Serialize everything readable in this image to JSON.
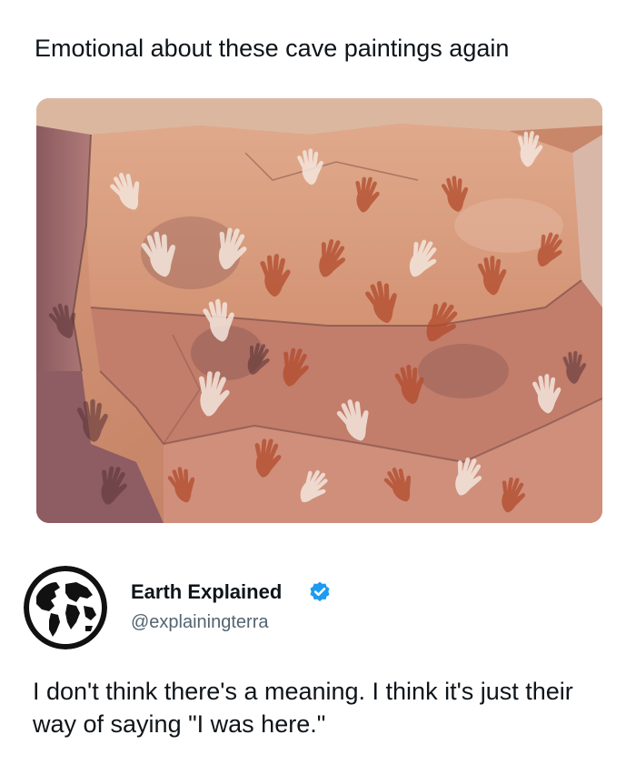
{
  "quoted_post": {
    "text": "Emotional about these cave paintings again",
    "image": {
      "subject": "cave-wall-hand-stencils",
      "colors": {
        "rock_base": "#c98a6c",
        "rock_light": "#e9c7b4",
        "pigment_red": "#b24a2c",
        "pigment_dark": "#6b3b3a",
        "shadow": "#7a4a4c"
      }
    }
  },
  "reply": {
    "author": {
      "name": "Earth Explained",
      "handle": "@explainingterra",
      "avatar_icon": "globe-icon",
      "verified_icon": "verified-badge-icon",
      "verified_color": "#1d9bf0"
    },
    "text": "I don't think there's a meaning. I think it's just their way of saying \"I was here.\""
  }
}
